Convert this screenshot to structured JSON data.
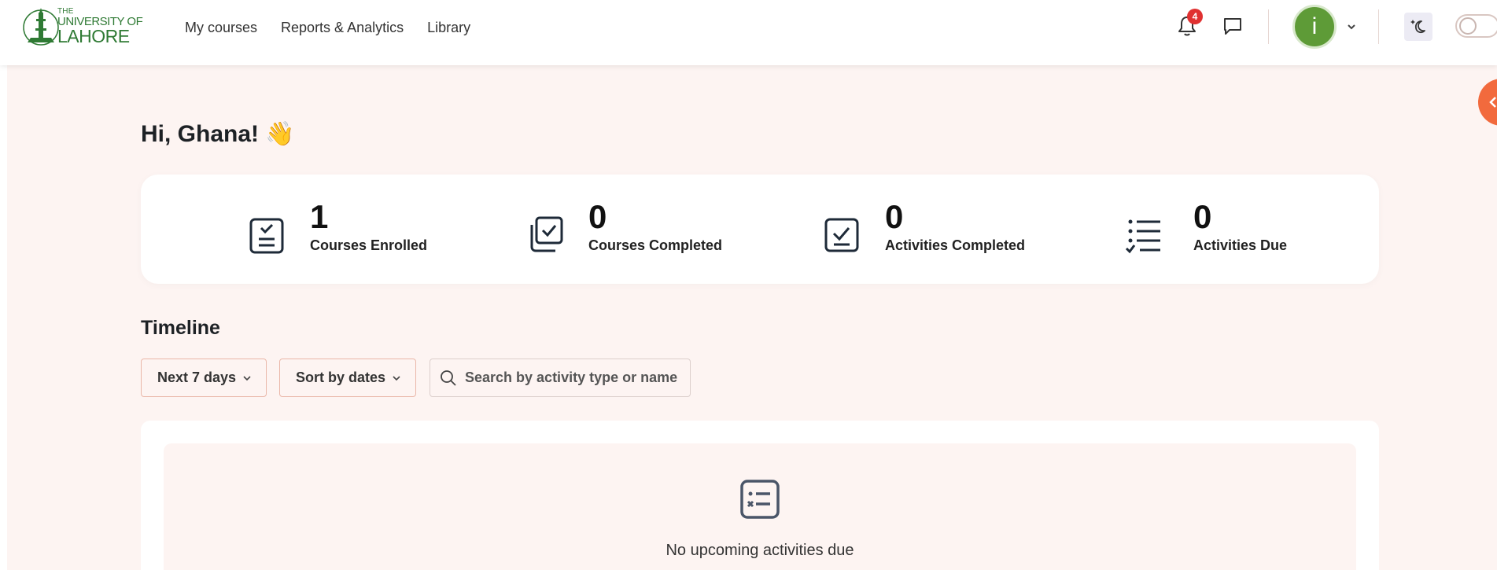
{
  "logo": {
    "line1": "THE",
    "line2": "UNIVERSITY OF",
    "line3": "LAHORE"
  },
  "nav": {
    "links": [
      "My courses",
      "Reports & Analytics",
      "Library"
    ]
  },
  "header": {
    "notification_count": "4",
    "avatar_letter": "i"
  },
  "greeting": {
    "text": "Hi, Ghana!",
    "emoji": "👋"
  },
  "stats": [
    {
      "value": "1",
      "label": "Courses Enrolled",
      "icon": "checklist-document-icon"
    },
    {
      "value": "0",
      "label": "Courses Completed",
      "icon": "stacked-check-icon"
    },
    {
      "value": "0",
      "label": "Activities Completed",
      "icon": "checkbox-icon"
    },
    {
      "value": "0",
      "label": "Activities Due",
      "icon": "list-check-icon"
    }
  ],
  "timeline": {
    "title": "Timeline",
    "range_filter": "Next 7 days",
    "sort_filter": "Sort by dates",
    "search_placeholder": "Search by activity type or name",
    "empty_message": "No upcoming activities due"
  },
  "colors": {
    "brand_green": "#2f7a34",
    "accent_orange": "#f26a3d",
    "badge_red": "#e03131",
    "page_bg": "#fdf4f2",
    "avatar_green": "#5e9b37"
  }
}
